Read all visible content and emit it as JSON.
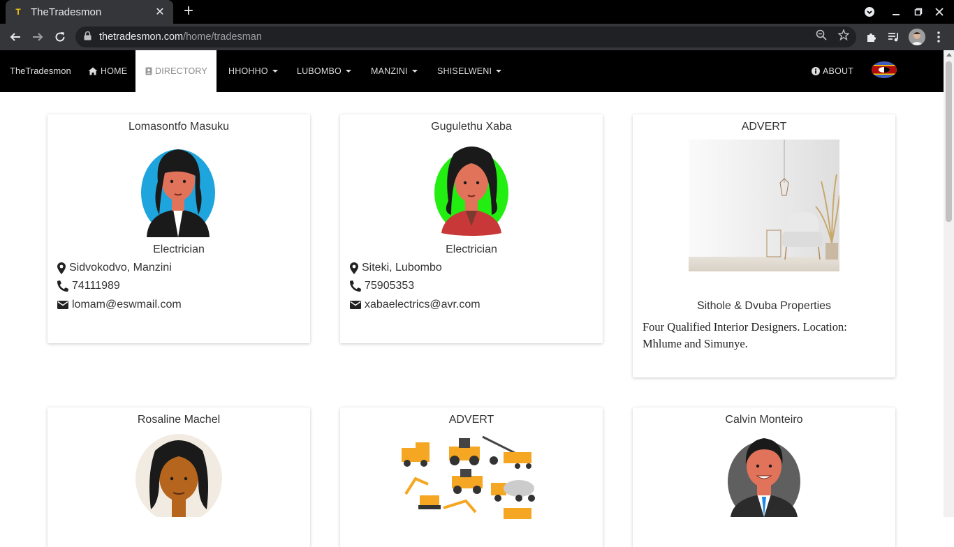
{
  "browser": {
    "tab_title": "TheTradesmon",
    "url_host": "thetradesmon.com",
    "url_path": "/home/tradesman"
  },
  "nav": {
    "brand": "TheTradesmon",
    "home": "HOME",
    "directory": "DIRECTORY",
    "regions": [
      "HHOHHO",
      "LUBOMBO",
      "MANZINI",
      "SHISELWENI"
    ],
    "about": "ABOUT"
  },
  "cards": {
    "c1": {
      "name": "Lomasontfo Masuku",
      "trade": "Electrician",
      "location": "Sidvokodvo, Manzini",
      "phone": "74111989",
      "email": "lomam@eswmail.com"
    },
    "c2": {
      "name": "Gugulethu Xaba",
      "trade": "Electrician",
      "location": "Siteki, Lubombo",
      "phone": "75905353",
      "email": "xabaelectrics@avr.com"
    },
    "c3": {
      "heading": "ADVERT",
      "company": "Sithole & Dvuba Properties",
      "text": "Four Qualified Interior Designers. Location: Mhlume and Simunye."
    },
    "c4": {
      "name": "Rosaline Machel"
    },
    "c5": {
      "heading": "ADVERT"
    },
    "c6": {
      "name": "Calvin Monteiro"
    }
  },
  "colors": {
    "accent_green": "#22ee11",
    "accent_blue": "#1ea5dd"
  }
}
